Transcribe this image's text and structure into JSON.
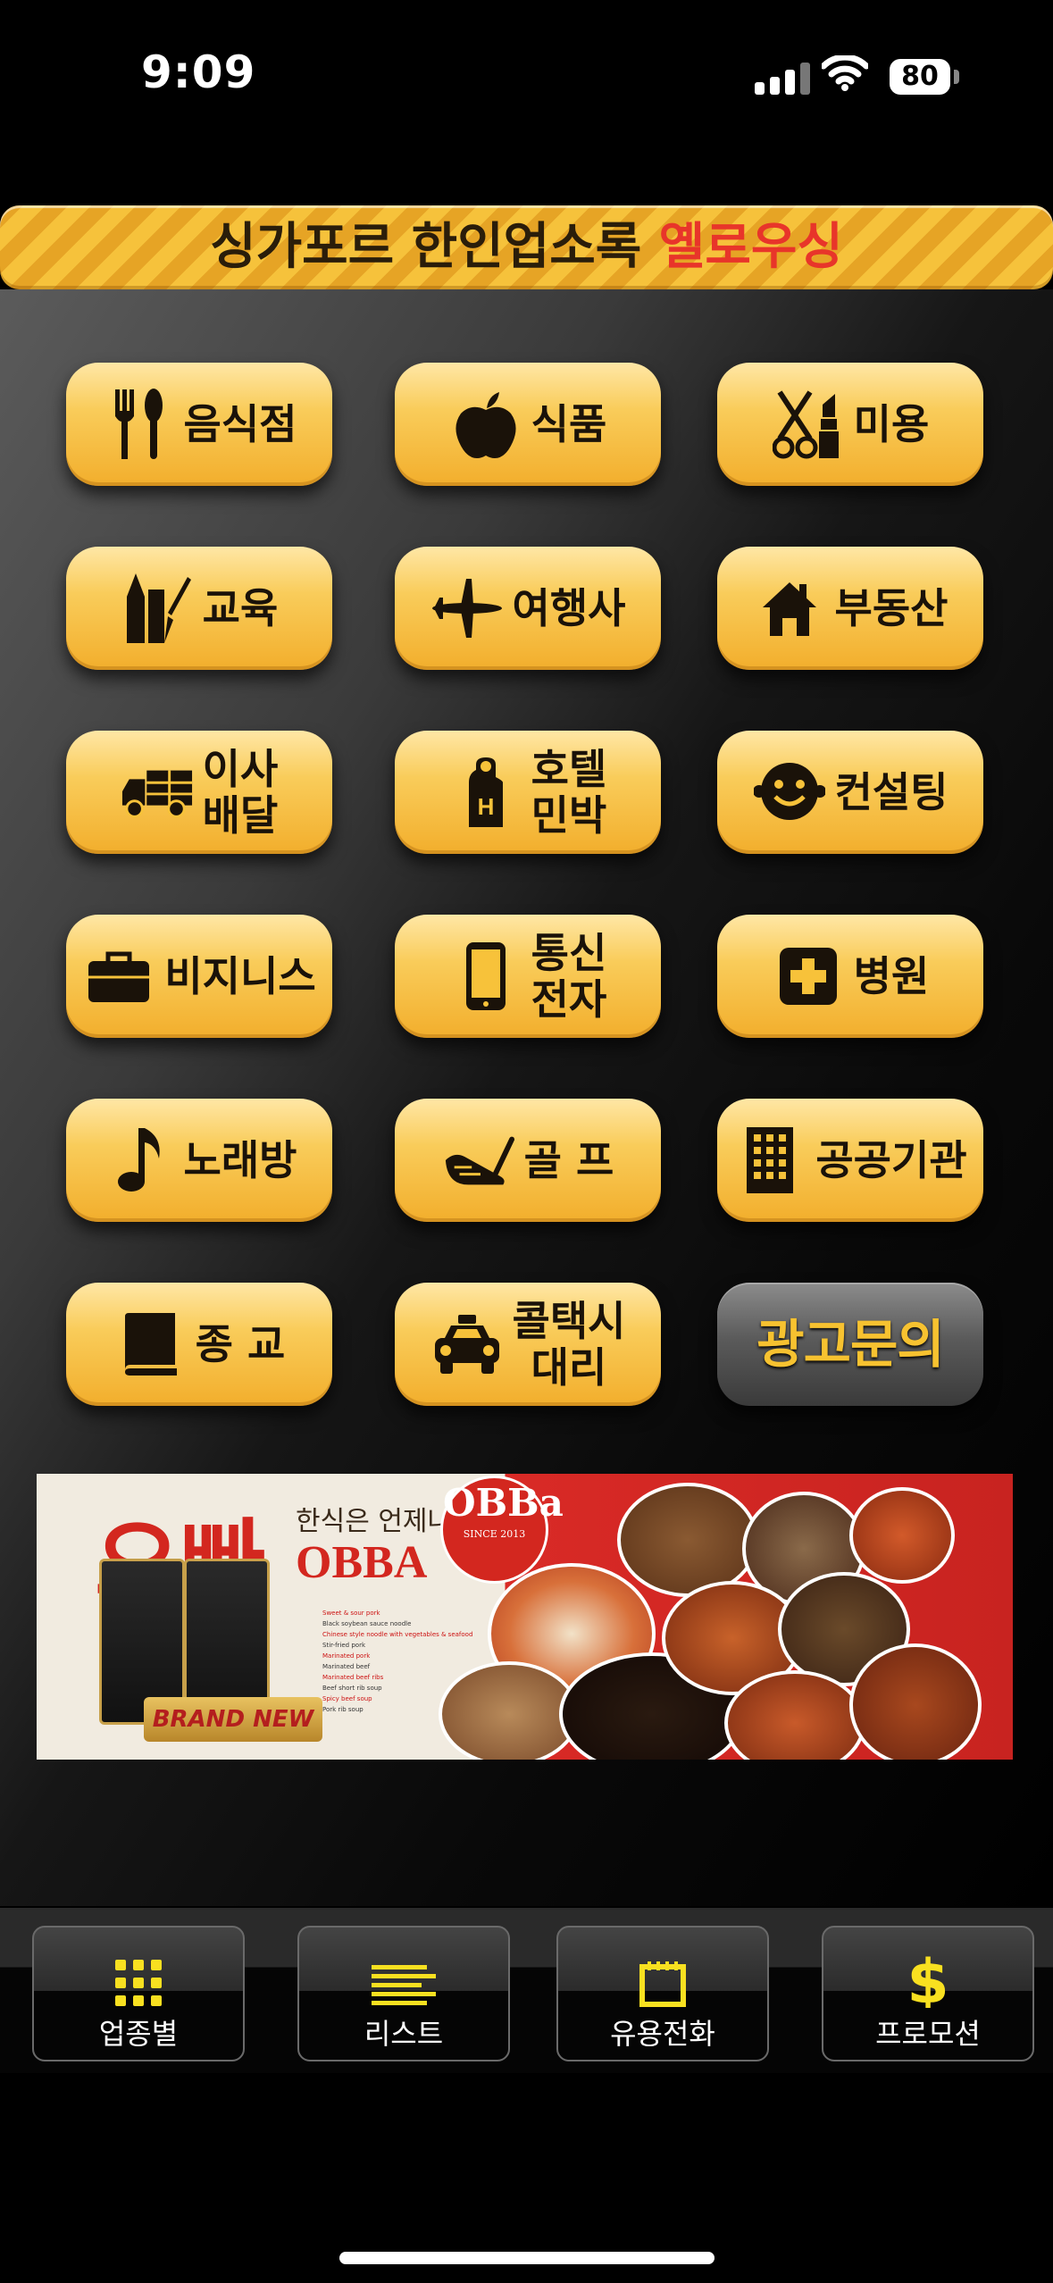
{
  "status": {
    "time": "9:09",
    "battery": "80"
  },
  "banner": {
    "title_part1": "싱가포르 한인업소록 ",
    "title_part2": "옐로우싱"
  },
  "categories": [
    {
      "line1": "음식점",
      "line2": "",
      "icon": "fork-spoon-icon"
    },
    {
      "line1": "식품",
      "line2": "",
      "icon": "apple-icon"
    },
    {
      "line1": "미용",
      "line2": "",
      "icon": "scissors-lipstick-icon"
    },
    {
      "line1": "교육",
      "line2": "",
      "icon": "pencils-icon"
    },
    {
      "line1": "여행사",
      "line2": "",
      "icon": "airplane-icon"
    },
    {
      "line1": "부동산",
      "line2": "",
      "icon": "house-icon"
    },
    {
      "line1": "이사",
      "line2": "배달",
      "icon": "truck-icon"
    },
    {
      "line1": "호텔",
      "line2": "민박",
      "icon": "door-hanger-icon"
    },
    {
      "line1": "컨설팅",
      "line2": "",
      "icon": "smiley-face-icon"
    },
    {
      "line1": "비지니스",
      "line2": "",
      "icon": "briefcase-icon"
    },
    {
      "line1": "통신",
      "line2": "전자",
      "icon": "mobile-phone-icon"
    },
    {
      "line1": "병원",
      "line2": "",
      "icon": "medical-cross-icon"
    },
    {
      "line1": "노래방",
      "line2": "",
      "icon": "music-note-icon"
    },
    {
      "line1": "골 프",
      "line2": "",
      "icon": "golf-club-icon"
    },
    {
      "line1": "공공기관",
      "line2": "",
      "icon": "building-icon"
    },
    {
      "line1": "종 교",
      "line2": "",
      "icon": "book-icon"
    },
    {
      "line1": "콜택시",
      "line2": "대리",
      "icon": "taxi-icon"
    },
    {
      "line1": "광고문의",
      "line2": "",
      "icon": ""
    }
  ],
  "ad": {
    "title": "오빠",
    "subtitle": "한식은 언제나 !!",
    "brand": "OBBA",
    "logo_text": "OBBa",
    "logo_since": "SINCE 2013",
    "ribbon": "BRAND NEW",
    "menu": [
      "Sweet & sour pork",
      "Black soybean sauce noodle",
      "Chinese style noodle with vegetables & seafood",
      "Stir-fried pork",
      "Marinated pork",
      "Marinated beef",
      "Marinated beef ribs",
      "Beef short rib soup",
      "Spicy beef soup",
      "Pork rib soup"
    ]
  },
  "tabs": [
    {
      "label": "업종별",
      "icon": "grid-icon"
    },
    {
      "label": "리스트",
      "icon": "list-icon"
    },
    {
      "label": "유용전화",
      "icon": "notepad-icon"
    },
    {
      "label": "프로모션",
      "icon": "dollar-icon"
    }
  ],
  "colors": {
    "accent_gold": "#f6c23b",
    "accent_red": "#e8352a",
    "background": "#000000"
  }
}
